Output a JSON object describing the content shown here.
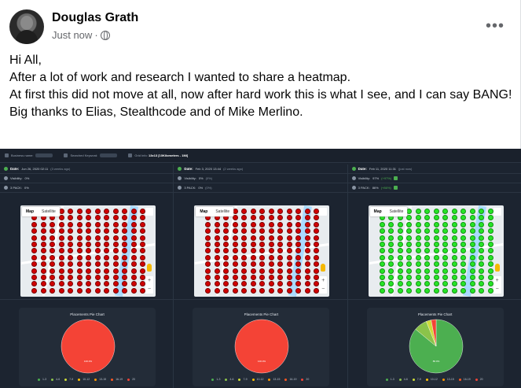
{
  "post": {
    "author": "Douglas Grath",
    "time": "Just now",
    "separator": "·",
    "more_label": "•••",
    "lines": [
      "Hi All,",
      "After a lot of work and research I wanted to share a heatmap.",
      "At first this did not move at all, now after hard work this is what I see, and I can say BANG!",
      "Big thanks to Elias, Stealthcode and of Mike Merlino."
    ]
  },
  "dashboard": {
    "topbar": {
      "business_label": "Business name:",
      "keyword_label": "Searched Keyword:",
      "grid_label": "Grid Info:",
      "grid_value": "13x13 [10Kilometers - 1Mi]"
    },
    "columns": [
      {
        "date_label": "Date:",
        "date_value": "Jun 26, 2020 02:11",
        "date_ago": "(3 weeks ago)",
        "visibility_label": "Visibility:",
        "visibility_value": "0%",
        "pack_label": "3 PACK:",
        "pack_value": "0%",
        "state": "red"
      },
      {
        "date_label": "Date:",
        "date_value": "Feb 3, 2020 13:44",
        "date_ago": "(2 weeks ago)",
        "visibility_label": "Visibility:",
        "visibility_value": "0%",
        "visibility_delta": "(0%)",
        "pack_label": "3 PACK:",
        "pack_value": "0%",
        "pack_delta": "(0%)",
        "state": "red"
      },
      {
        "date_label": "Date:",
        "date_value": "Feb 11, 2020 11:31",
        "date_ago": "(just now)",
        "visibility_label": "Visibility:",
        "visibility_value": "97%",
        "visibility_delta": "(+97%)",
        "pack_label": "3 PACK:",
        "pack_value": "86%",
        "pack_delta": "(+86%)",
        "state": "green"
      }
    ],
    "map_tabs": [
      "Map",
      "Satellite"
    ],
    "pie_title": "Placements Pie Chart",
    "legend": [
      {
        "label": "1-3",
        "color": "#4caf50"
      },
      {
        "label": "4-6",
        "color": "#8bc34a"
      },
      {
        "label": "7-9",
        "color": "#cddc39"
      },
      {
        "label": "10-12",
        "color": "#ffc107"
      },
      {
        "label": "13-15",
        "color": "#ff9800"
      },
      {
        "label": "16-19",
        "color": "#ff5722"
      },
      {
        "label": "20",
        "color": "#f44336"
      }
    ]
  },
  "chart_data": [
    {
      "type": "pie",
      "title": "Placements Pie Chart",
      "slices": [
        {
          "label": "20",
          "value": 100,
          "color": "#f44336"
        }
      ],
      "center_label": "100.0%"
    },
    {
      "type": "pie",
      "title": "Placements Pie Chart",
      "slices": [
        {
          "label": "20",
          "value": 100,
          "color": "#f44336"
        }
      ],
      "center_label": "100.0%"
    },
    {
      "type": "pie",
      "title": "Placements Pie Chart",
      "slices": [
        {
          "label": "1-3",
          "value": 86,
          "color": "#4caf50"
        },
        {
          "label": "4-6",
          "value": 8,
          "color": "#8bc34a"
        },
        {
          "label": "7-9",
          "value": 3,
          "color": "#cddc39"
        },
        {
          "label": "20",
          "value": 3,
          "color": "#f44336"
        }
      ],
      "center_label": "86.0%"
    }
  ]
}
